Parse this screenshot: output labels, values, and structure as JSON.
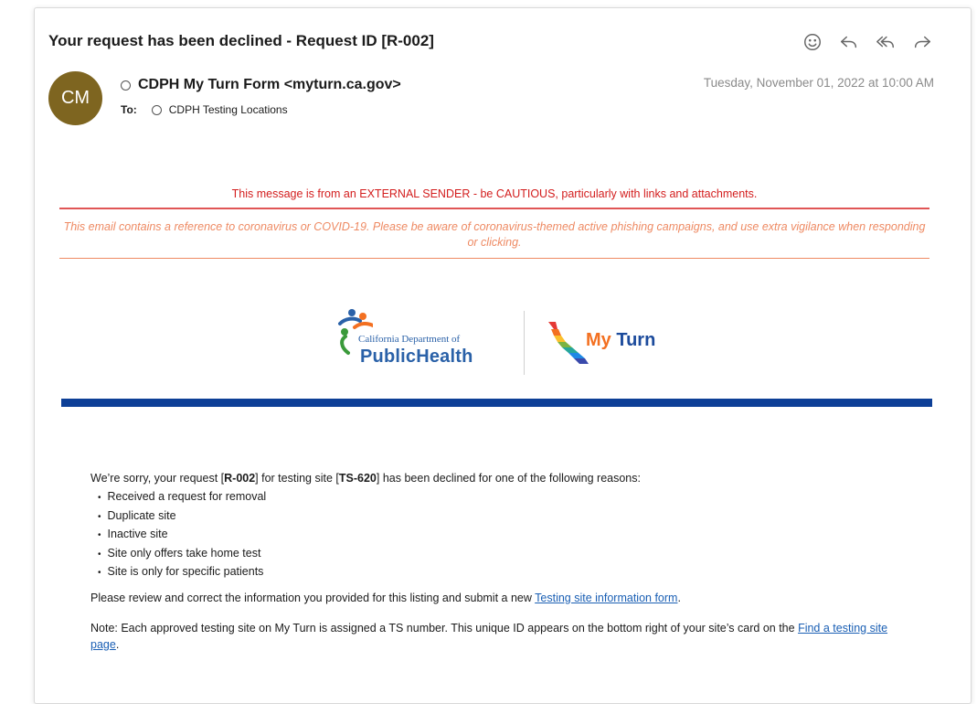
{
  "email": {
    "subject": "Your request has been declined - Request ID [R-002]",
    "actions": [
      "smiley-icon",
      "reply-icon",
      "reply-all-icon",
      "forward-icon"
    ],
    "avatar_initials": "CM",
    "avatar_color": "#7e6520",
    "from": "CDPH My Turn Form <myturn.ca.gov>",
    "to_label": "To:",
    "to": "CDPH Testing Locations",
    "date": "Tuesday, November 01, 2022 at 10:00 AM"
  },
  "banners": {
    "external_warning": "This message is from an EXTERNAL SENDER - be CAUTIOUS, particularly with links and attachments.",
    "covid_warning": "This email contains a reference to coronavirus or COVID-19. Please be aware of coronavirus-themed active phishing campaigns, and use extra vigilance when responding or clicking.",
    "external_color": "#d31d1d",
    "covid_color": "#ee8a63"
  },
  "logos": {
    "cdph_small": "California Department of",
    "cdph_big": "PublicHealth",
    "myturn_my": "My",
    "myturn_turn": "Turn",
    "brand_blue": "#0d3f97"
  },
  "body": {
    "intro_1": "We’re sorry, your request [",
    "request_id": "R-002",
    "intro_2": "] for testing site [",
    "site_id": "TS-620",
    "intro_3": "] has been declined for one of the following reasons:",
    "reasons": [
      "Received a request for removal",
      "Duplicate site",
      "Inactive site",
      "Site only offers take home test",
      "Site is only for specific patients"
    ],
    "p1_text": "Please review and correct the information you provided for this listing and submit a new ",
    "p1_link": "Testing site information form",
    "p1_end": ".",
    "p2_text": "Note: Each approved testing site on My Turn is assigned a TS number. This unique ID appears on the bottom right of your site’s card on the ",
    "p2_link": "Find a testing site page",
    "p2_end": "."
  }
}
